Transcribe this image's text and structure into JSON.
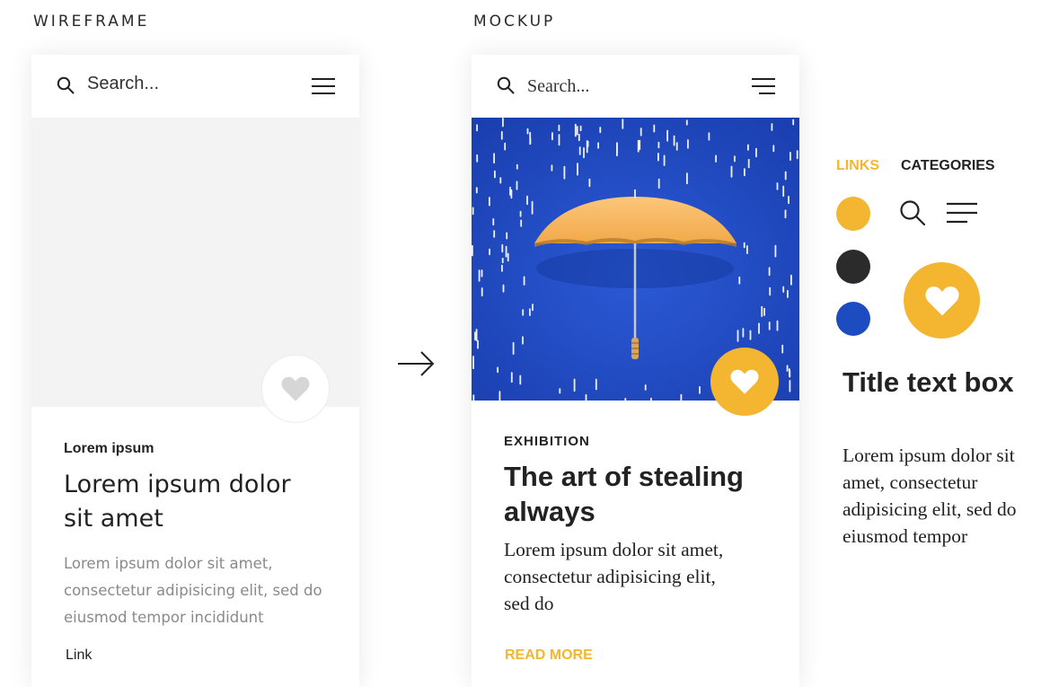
{
  "colors": {
    "accent_yellow": "#f4b531",
    "dark": "#2b2b2b",
    "blue": "#1d4cc0",
    "wireframe_gray": "#f3f3f3"
  },
  "wireframe": {
    "section_label": "WIREFRAME",
    "search_placeholder": "Search...",
    "kicker": "Lorem ipsum",
    "headline": "Lorem ipsum dolor sit amet",
    "body": "Lorem ipsum dolor sit amet, consectetur adipisicing elit, sed do eiusmod tempor incididunt",
    "link": "Link",
    "icons": [
      "search-icon",
      "menu-icon",
      "heart-icon"
    ]
  },
  "mockup": {
    "section_label": "MOCKUP",
    "search_placeholder": "Search...",
    "kicker": "EXHIBITION",
    "headline": "The art of stealing always",
    "body": "Lorem ipsum dolor sit amet, consectetur adipisicing elit, sed do",
    "read_more": "READ MORE",
    "hero_image": "yellow umbrella in blue rain",
    "icons": [
      "search-icon",
      "menu-icon",
      "heart-icon"
    ]
  },
  "style_guide": {
    "links_label": "LINKS",
    "categories_label": "CATEGORIES",
    "swatches": [
      "#f4b531",
      "#2b2b2b",
      "#1d4cc0"
    ],
    "title": "Title text box",
    "body": "Lorem ipsum dolor sit amet, consectetur adipisicing elit, sed do eiusmod tempor",
    "icons": [
      "search-icon",
      "menu-icon",
      "heart-icon"
    ]
  }
}
